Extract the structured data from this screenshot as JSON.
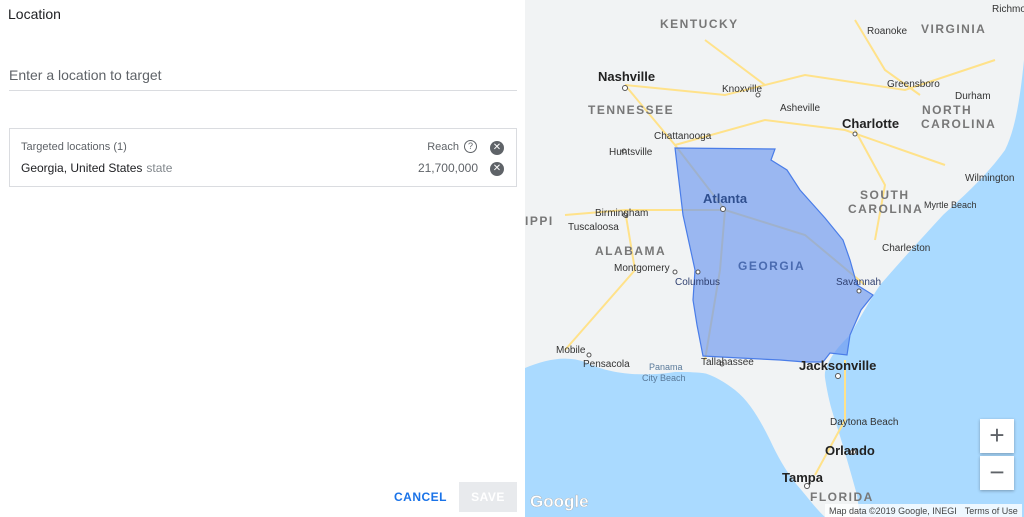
{
  "panel": {
    "title": "Location",
    "search_placeholder": "Enter a location to target",
    "targeted_header": "Targeted locations (1)",
    "reach_label": "Reach",
    "help_glyph": "?",
    "remove_glyph": "✕",
    "locations": [
      {
        "name": "Georgia, United States",
        "type": "state",
        "reach": "21,700,000"
      }
    ],
    "cancel_label": "CANCEL",
    "save_label": "SAVE"
  },
  "map": {
    "zoom_in": "+",
    "zoom_out": "−",
    "logo": "Google",
    "attribution": "Map data ©2019 Google, INEGI",
    "terms": "Terms of Use",
    "labels": {
      "kentucky": "KENTUCKY",
      "virginia": "VIRGINIA",
      "richmond": "Richmo",
      "roanoke": "Roanoke",
      "nashville": "Nashville",
      "knoxville": "Knoxville",
      "greensboro": "Greensboro",
      "durham": "Durham",
      "asheville": "Asheville",
      "tennessee": "TENNESSEE",
      "north": "NORTH",
      "carolina": "CAROLINA",
      "charlotte": "Charlotte",
      "chattanooga": "Chattanooga",
      "huntsville": "Huntsville",
      "wilmington": "Wilmington",
      "south": "SOUTH",
      "carolina2": "CAROLINA",
      "myrtle": "Myrtle Beach",
      "atlanta": "Atlanta",
      "birmingham": "Birmingham",
      "ippi": "IPPI",
      "tuscaloosa": "Tuscaloosa",
      "alabama": "ALABAMA",
      "georgia": "GEORGIA",
      "charleston": "Charleston",
      "montgomery": "Montgomery",
      "columbus": "Columbus",
      "savannah": "Savannah",
      "mobile": "Mobile",
      "pensacola": "Pensacola",
      "panama1": "Panama",
      "panama2": "City Beach",
      "tallahassee": "Tallahassee",
      "jacksonville": "Jacksonville",
      "daytona": "Daytona Beach",
      "orlando": "Orlando",
      "tampa": "Tampa",
      "florida": "FLORIDA"
    }
  },
  "colors": {
    "accent": "#1a73e8",
    "water": "#aadaff",
    "land": "#f1f3f4",
    "highlight": "#6b96f0"
  }
}
